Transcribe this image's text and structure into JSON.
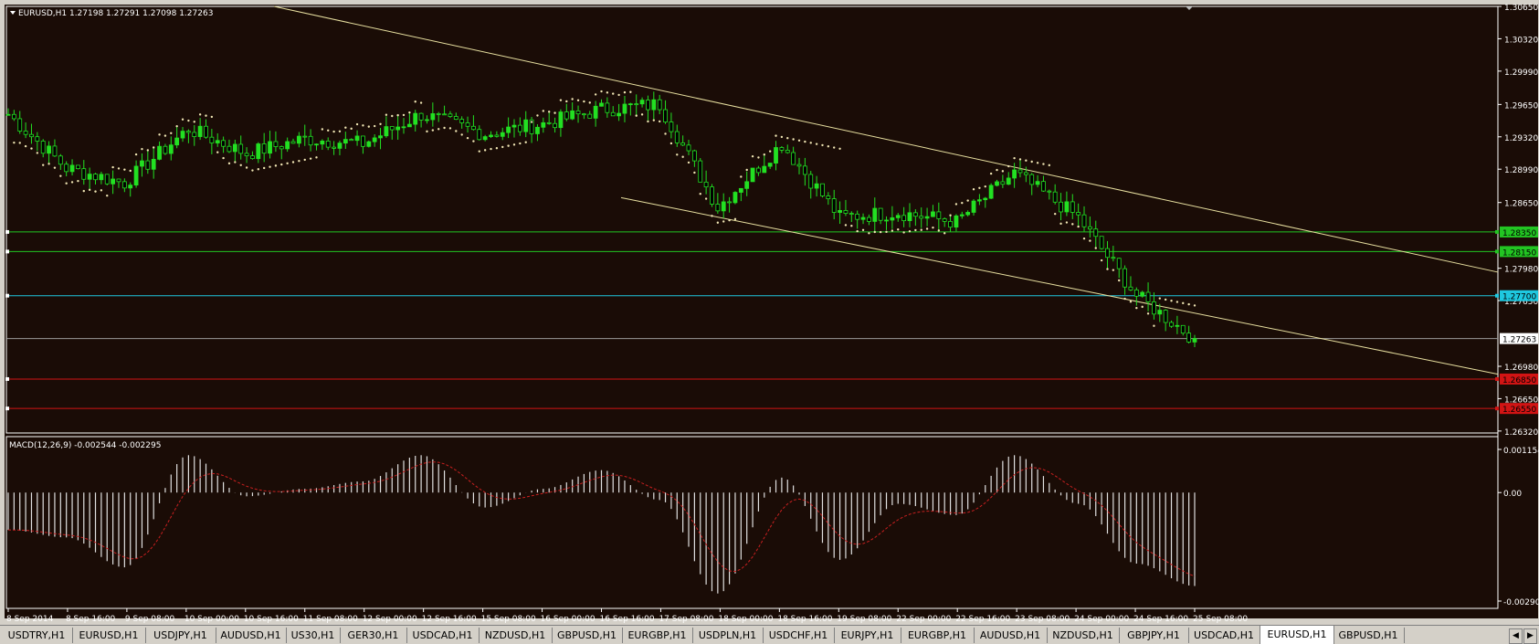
{
  "main_chart": {
    "header": "EURUSD,H1  1.27198 1.27291 1.27098 1.27263",
    "y_ticks": [
      "1.30650",
      "1.30320",
      "1.29990",
      "1.29650",
      "1.29320",
      "1.28990",
      "1.28650",
      "1.27980",
      "1.27650",
      "1.26980",
      "1.26650",
      "1.26320"
    ],
    "current_price": "1.27263",
    "hlines": [
      {
        "label": "1.28350",
        "price": 1.2835,
        "color": "#22c522"
      },
      {
        "label": "1.28150",
        "price": 1.2815,
        "color": "#22c522"
      },
      {
        "label": "1.27700",
        "price": 1.277,
        "color": "#1ec8e0"
      },
      {
        "label": "1.26850",
        "price": 1.2685,
        "color": "#d21414"
      },
      {
        "label": "1.26550",
        "price": 1.2655,
        "color": "#d21414"
      }
    ]
  },
  "macd_panel": {
    "header": "MACD(12,26,9) -0.002544 -0.002295",
    "y_ticks": [
      "0.001154",
      "0.00",
      "-0.002903"
    ]
  },
  "x_ticks": [
    "8 Sep 2014",
    "8 Sep 16:00",
    "9 Sep 08:00",
    "10 Sep 00:00",
    "10 Sep 16:00",
    "11 Sep 08:00",
    "12 Sep 00:00",
    "12 Sep 16:00",
    "15 Sep 08:00",
    "16 Sep 00:00",
    "16 Sep 16:00",
    "17 Sep 08:00",
    "18 Sep 00:00",
    "18 Sep 16:00",
    "19 Sep 08:00",
    "22 Sep 00:00",
    "22 Sep 16:00",
    "23 Sep 08:00",
    "24 Sep 00:00",
    "24 Sep 16:00",
    "25 Sep 08:00"
  ],
  "tabs": [
    "USDTRY,H1",
    "EURUSD,H1",
    "USDJPY,H1",
    "AUDUSD,H1",
    "US30,H1",
    "GER30,H1",
    "USDCAD,H1",
    "NZDUSD,H1",
    "GBPUSD,H1",
    "EURGBP,H1",
    "USDPLN,H1",
    "USDCHF,H1",
    "EURJPY,H1",
    "EURGBP,H1",
    "AUDUSD,H1",
    "NZDUSD,H1",
    "GBPJPY,H1",
    "USDCAD,H1",
    "EURUSD,H1",
    "GBPUSD,H1"
  ],
  "active_tab": 18,
  "colors": {
    "background": "#1a0c06",
    "bull": "#22e022",
    "bear": "#22e022",
    "sar": "#f0e6b4",
    "trendline": "#e8e0a0",
    "macd_hist": "#e0e0e0",
    "macd_signal": "#c82020",
    "grid_text": "#ffffff"
  },
  "chart_data": [
    {
      "type": "candlestick",
      "symbol": "EURUSD",
      "timeframe": "H1",
      "y_range": [
        1.263,
        1.3065
      ],
      "ohlc_last": {
        "open": 1.27198,
        "high": 1.27291,
        "low": 1.27098,
        "close": 1.27263
      },
      "approx_close_path": [
        {
          "x": "8 Sep 2014",
          "y": 1.2955
        },
        {
          "x": "8 Sep 16:00",
          "y": 1.29
        },
        {
          "x": "9 Sep 08:00",
          "y": 1.2885
        },
        {
          "x": "10 Sep 00:00",
          "y": 1.294
        },
        {
          "x": "10 Sep 16:00",
          "y": 1.2915
        },
        {
          "x": "11 Sep 08:00",
          "y": 1.293
        },
        {
          "x": "12 Sep 00:00",
          "y": 1.2925
        },
        {
          "x": "12 Sep 16:00",
          "y": 1.2955
        },
        {
          "x": "15 Sep 08:00",
          "y": 1.2935
        },
        {
          "x": "16 Sep 00:00",
          "y": 1.2945
        },
        {
          "x": "16 Sep 16:00",
          "y": 1.296
        },
        {
          "x": "17 Sep 08:00",
          "y": 1.2965
        },
        {
          "x": "18 Sep 00:00",
          "y": 1.286
        },
        {
          "x": "18 Sep 16:00",
          "y": 1.2925
        },
        {
          "x": "19 Sep 08:00",
          "y": 1.285
        },
        {
          "x": "22 Sep 00:00",
          "y": 1.2855
        },
        {
          "x": "22 Sep 16:00",
          "y": 1.2845
        },
        {
          "x": "23 Sep 08:00",
          "y": 1.2895
        },
        {
          "x": "24 Sep 00:00",
          "y": 1.285
        },
        {
          "x": "24 Sep 16:00",
          "y": 1.277
        },
        {
          "x": "25 Sep 08:00",
          "y": 1.2726
        }
      ]
    },
    {
      "type": "bar",
      "name": "MACD(12,26,9)",
      "y_range": [
        -0.002903,
        0.001154
      ],
      "last_values": {
        "main": -0.002544,
        "signal": -0.002295
      },
      "approx_values": [
        {
          "x": "8 Sep 2014",
          "y": -0.001
        },
        {
          "x": "8 Sep 16:00",
          "y": -0.0012
        },
        {
          "x": "9 Sep 08:00",
          "y": -0.002
        },
        {
          "x": "10 Sep 00:00",
          "y": 0.001
        },
        {
          "x": "10 Sep 16:00",
          "y": -0.0001
        },
        {
          "x": "11 Sep 08:00",
          "y": 0.0001
        },
        {
          "x": "12 Sep 00:00",
          "y": 0.0003
        },
        {
          "x": "12 Sep 16:00",
          "y": 0.001
        },
        {
          "x": "15 Sep 08:00",
          "y": -0.0004
        },
        {
          "x": "16 Sep 00:00",
          "y": 0.0001
        },
        {
          "x": "16 Sep 16:00",
          "y": 0.0006
        },
        {
          "x": "17 Sep 08:00",
          "y": -0.0002
        },
        {
          "x": "18 Sep 00:00",
          "y": -0.0027
        },
        {
          "x": "18 Sep 16:00",
          "y": 0.0004
        },
        {
          "x": "19 Sep 08:00",
          "y": -0.0018
        },
        {
          "x": "22 Sep 00:00",
          "y": -0.0003
        },
        {
          "x": "22 Sep 16:00",
          "y": -0.0006
        },
        {
          "x": "23 Sep 08:00",
          "y": 0.001
        },
        {
          "x": "24 Sep 00:00",
          "y": -0.0003
        },
        {
          "x": "24 Sep 16:00",
          "y": -0.0019
        },
        {
          "x": "25 Sep 08:00",
          "y": -0.0025
        }
      ]
    }
  ]
}
